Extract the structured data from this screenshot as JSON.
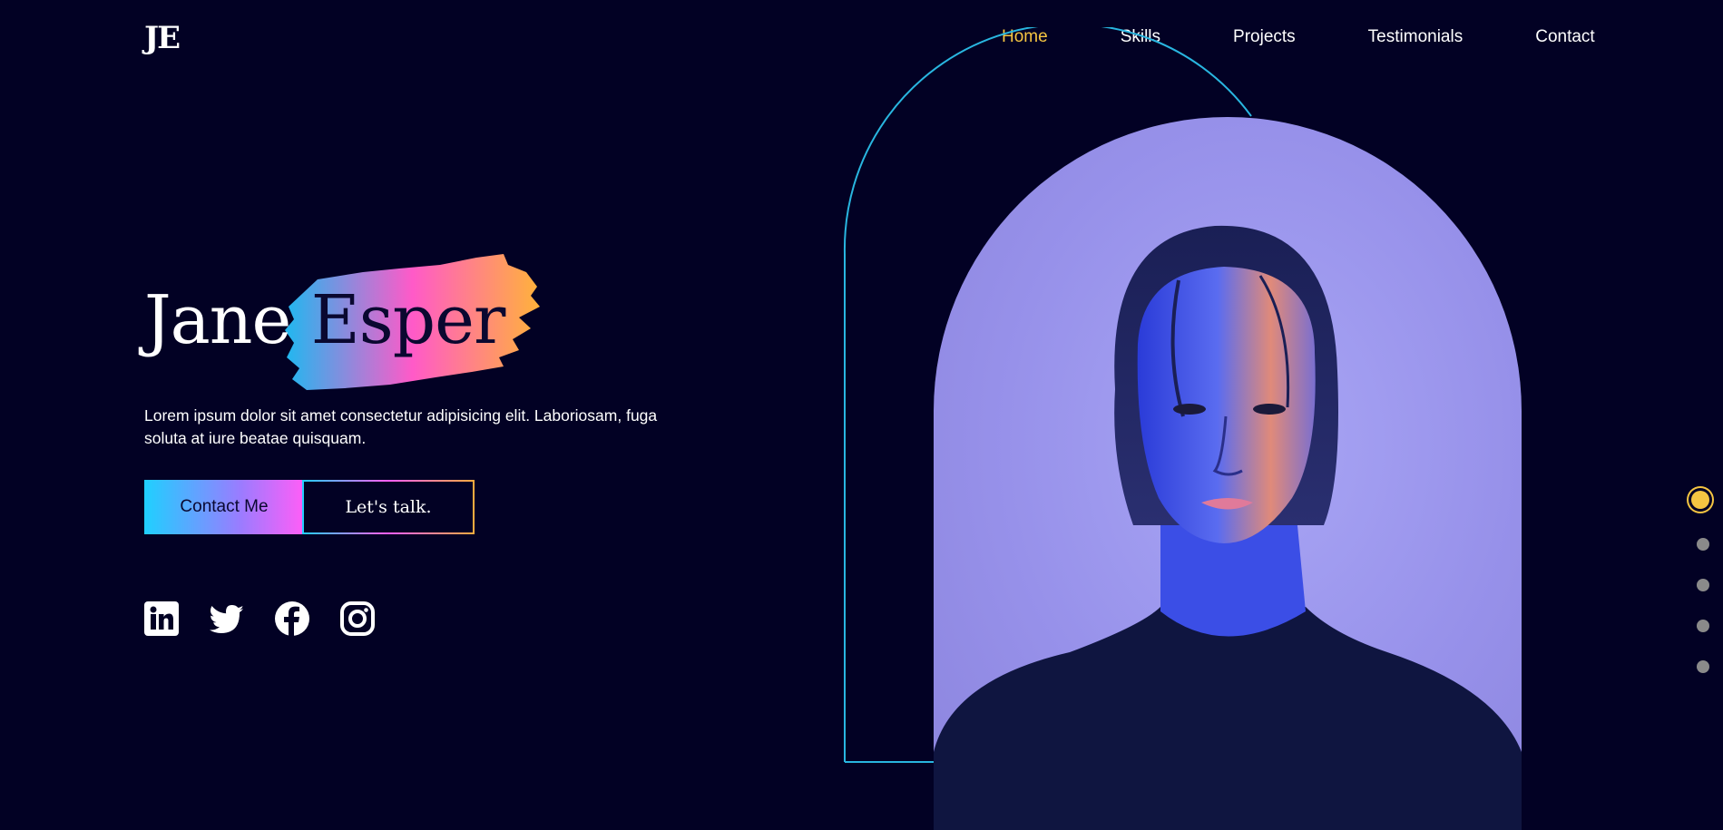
{
  "logo": "JE",
  "nav": {
    "items": [
      {
        "label": "Home",
        "active": true
      },
      {
        "label": "Skills",
        "active": false
      },
      {
        "label": "Projects",
        "active": false
      },
      {
        "label": "Testimonials",
        "active": false
      },
      {
        "label": "Contact",
        "active": false
      }
    ]
  },
  "hero": {
    "first_name": "Jane",
    "last_name": "Esper",
    "intro": "Lorem ipsum dolor sit amet consectetur adipisicing elit. Laboriosam, fuga soluta at iure beatae quisquam.",
    "contact_button": "Contact Me",
    "talk_button": "Let's talk."
  },
  "social": [
    "linkedin-icon",
    "twitter-icon",
    "facebook-icon",
    "instagram-icon"
  ],
  "side_nav": {
    "count": 5,
    "active_index": 0
  },
  "colors": {
    "background": "#020124",
    "accent": "#f5c542",
    "outline": "#29b6e0",
    "gradient_start": "#1fd0ff",
    "gradient_mid": "#ff5ef7",
    "gradient_end": "#ffab3d"
  }
}
